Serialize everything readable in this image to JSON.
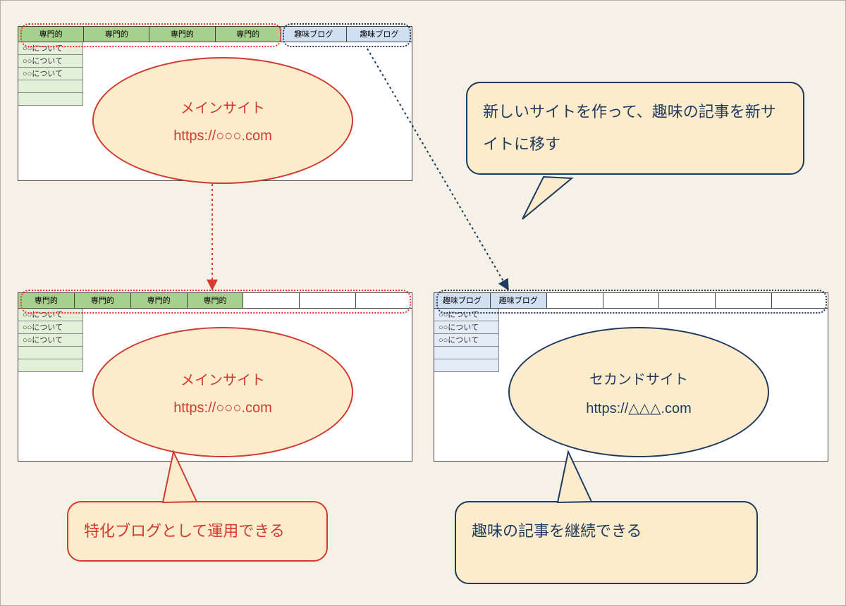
{
  "panels": {
    "topMain": {
      "tabs": [
        "専門的",
        "専門的",
        "専門的",
        "専門的",
        "趣味ブログ",
        "趣味ブログ"
      ],
      "rows": [
        "○○について",
        "○○について",
        "○○について"
      ]
    },
    "bottomMain": {
      "tabs": [
        "専門的",
        "専門的",
        "専門的",
        "専門的",
        "",
        "",
        ""
      ],
      "rows": [
        "○○について",
        "○○について",
        "○○について"
      ]
    },
    "bottomSecond": {
      "tabs": [
        "趣味ブログ",
        "趣味ブログ",
        "",
        "",
        "",
        "",
        ""
      ],
      "rows": [
        "○○について",
        "○○について",
        "○○について"
      ]
    }
  },
  "ellipses": {
    "topMain": {
      "title": "メインサイト",
      "url": "https://○○○.com"
    },
    "bottomMain": {
      "title": "メインサイト",
      "url": "https://○○○.com"
    },
    "second": {
      "title": "セカンドサイト",
      "url": "https://△△△.com"
    }
  },
  "bubbles": {
    "move": "新しいサイトを作って、趣味の記事を新サイトに移す",
    "left": "特化ブログとして運用できる",
    "right": "趣味の記事を継続できる"
  }
}
